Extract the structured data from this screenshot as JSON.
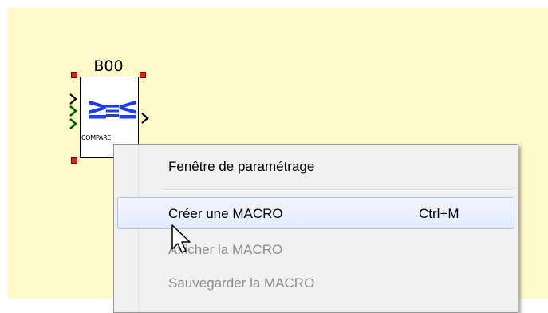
{
  "canvas": {
    "background": "#fffbc8"
  },
  "block": {
    "title": "B00",
    "symbol_ge": "≥",
    "symbol_eq": "≡",
    "symbol_le": "≤",
    "subtitle": "COMPARE"
  },
  "context_menu": {
    "items": [
      {
        "label": "Fenêtre de paramétrage",
        "shortcut": "",
        "state": "enabled"
      },
      {
        "label": "Créer une MACRO",
        "shortcut": "Ctrl+M",
        "state": "highlighted"
      },
      {
        "label": "Afficher la MACRO",
        "shortcut": "",
        "state": "disabled"
      },
      {
        "label": "Sauvegarder la MACRO",
        "shortcut": "",
        "state": "disabled"
      }
    ]
  },
  "colors": {
    "handle": "#e02020",
    "input_arrow_active": "#10b000",
    "symbol_blue": "#1d3fe0",
    "menu_highlight_border": "#a8c8ef"
  },
  "icons": {
    "cursor": "arrow-pointer-icon",
    "input_arrows": "chevron-right-icon"
  }
}
